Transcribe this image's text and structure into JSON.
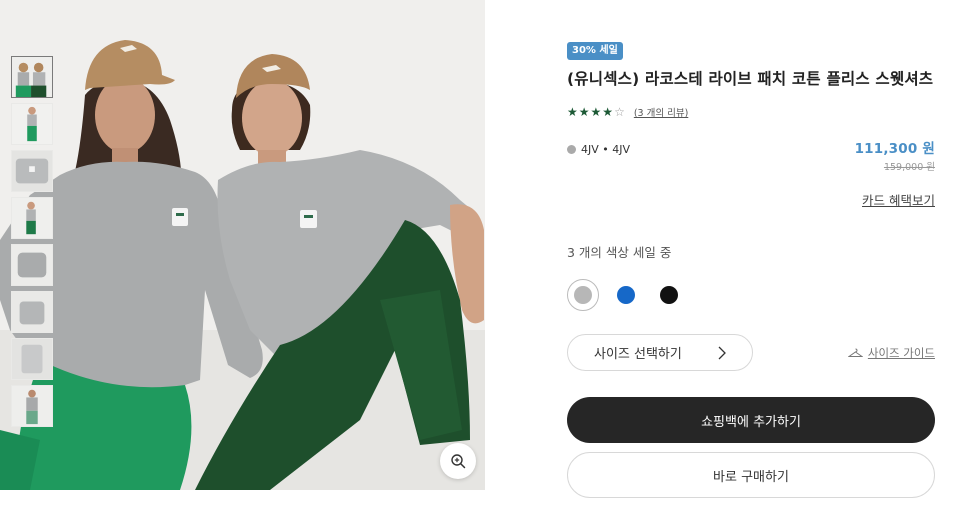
{
  "product": {
    "badge": "30% 세일",
    "title": "(유니섹스) 라코스테 라이브 패치 코튼 플리스 스웻셔츠",
    "rating": {
      "value": 4,
      "max": 5,
      "reviews_label": "(3 개의 리뷰)"
    },
    "code": "4JV • 4JV",
    "code_dot_color": "#aaaaaa",
    "price_sale": "111,300 원",
    "price_original": "159,000 원",
    "card_benefit_label": "카드 혜택보기",
    "color_sale_label": "3 개의 색상 세일 중",
    "colors": [
      {
        "name": "grey",
        "hex": "#b7b7b7",
        "selected": true
      },
      {
        "name": "blue",
        "hex": "#1668c8",
        "selected": false
      },
      {
        "name": "black",
        "hex": "#111111",
        "selected": false
      }
    ],
    "size_select_label": "사이즈 선택하기",
    "size_guide_label": "사이즈 가이드",
    "add_to_bag_label": "쇼핑백에 추가하기",
    "buy_now_label": "바로 구매하기"
  },
  "gallery": {
    "thumbnail_count": 8,
    "active_thumbnail": 0,
    "zoom_icon": "zoom-in-icon"
  },
  "colors": {
    "accent": "#4a8fc6",
    "star": "#1d5a36",
    "primary_button": "#262626"
  }
}
